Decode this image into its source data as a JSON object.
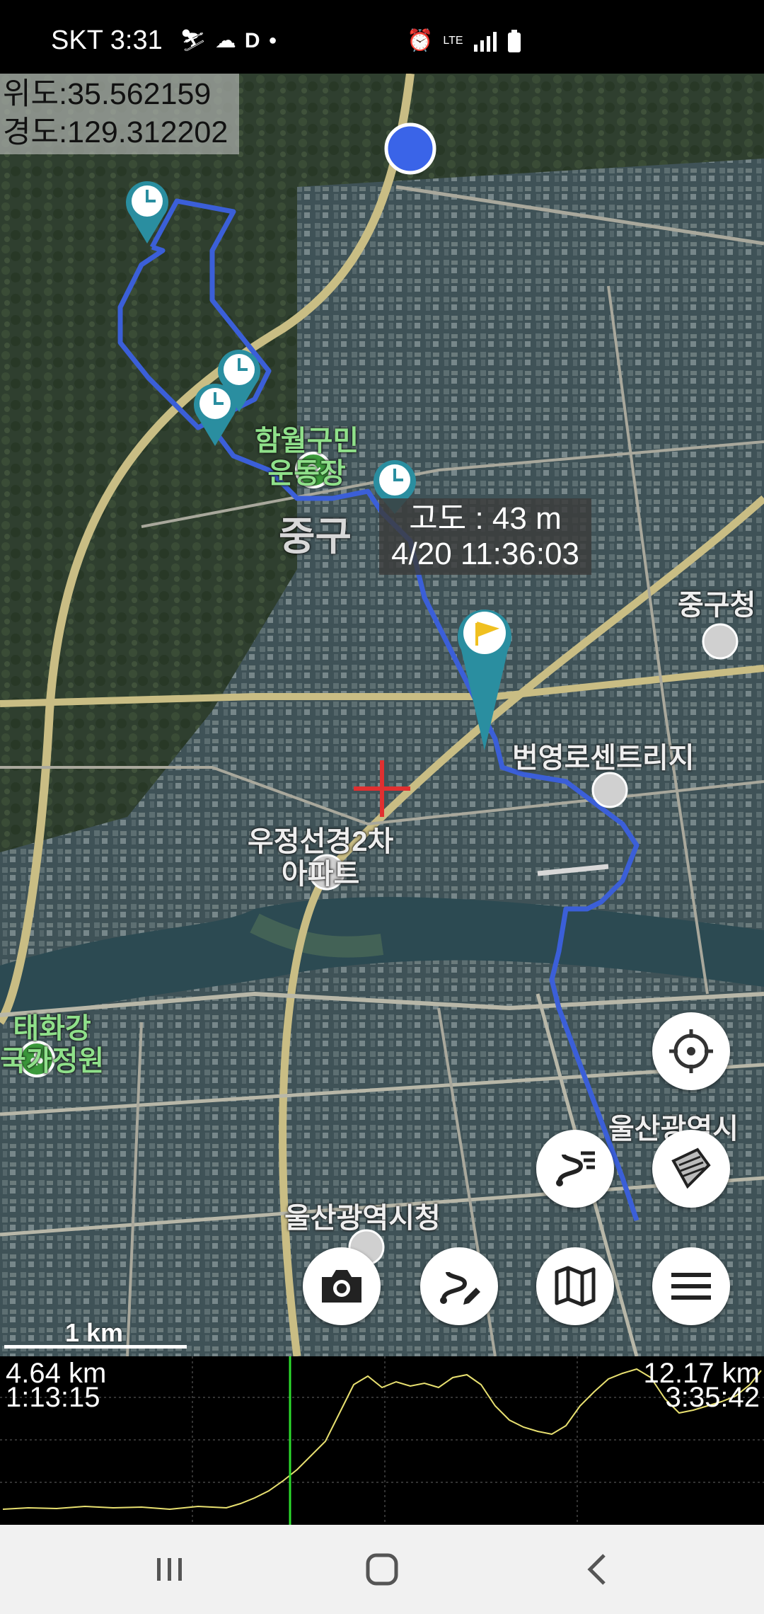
{
  "status_bar": {
    "carrier_time": "SKT 3:31",
    "lte": "LTE"
  },
  "coordinates": {
    "latitude": "위도:35.562159",
    "longitude": "경도:129.312202"
  },
  "map_labels": {
    "stadium": "함월구민\n운동장",
    "district": "중구",
    "ward_office": "중구청",
    "bridge": "번영로센트리지",
    "apartment": "우정선경2차\n아파트",
    "garden": "태화강\n국가정원",
    "city_hall": "울산광역시청",
    "city_right": "울산광역시\n남"
  },
  "tooltip": {
    "altitude": "고도 : 43 m",
    "datetime": "4/20 11:36:03"
  },
  "scale": {
    "label": "1 km"
  },
  "graph": {
    "current_distance": "4.64 km",
    "current_time": "1:13:15",
    "total_distance": "12.17 km",
    "total_time": "3:35:42",
    "cursor_fraction": 0.38
  },
  "fab_buttons": [
    "my-location",
    "layers",
    "route-list",
    "camera",
    "route-edit",
    "map",
    "menu"
  ],
  "colors": {
    "track": "#3b5fd8",
    "marker": "#2a8ea0",
    "graph_line": "#e8e070",
    "graph_cursor": "#2ddc2d"
  }
}
